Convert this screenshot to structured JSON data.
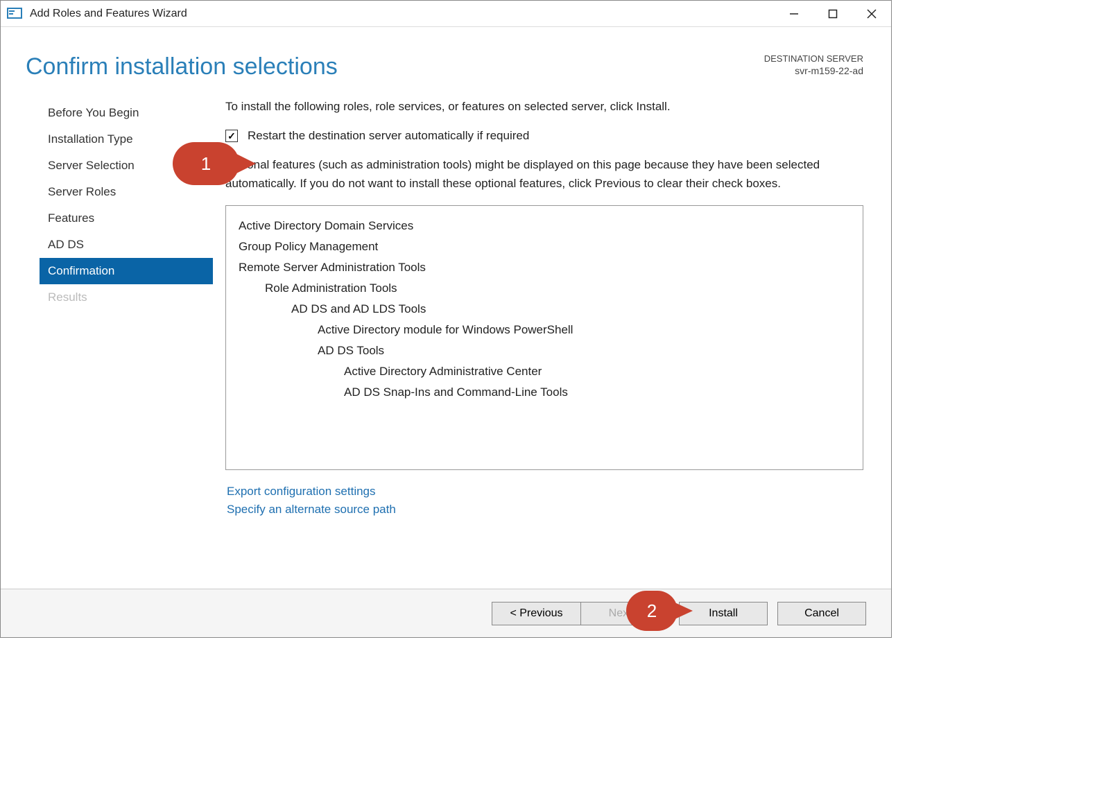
{
  "window": {
    "title": "Add Roles and Features Wizard"
  },
  "header": {
    "heading": "Confirm installation selections",
    "destLabel": "DESTINATION SERVER",
    "destValue": "svr-m159-22-ad"
  },
  "sidebar": {
    "items": [
      {
        "label": "Before You Begin",
        "active": false,
        "disabled": false
      },
      {
        "label": "Installation Type",
        "active": false,
        "disabled": false
      },
      {
        "label": "Server Selection",
        "active": false,
        "disabled": false
      },
      {
        "label": "Server Roles",
        "active": false,
        "disabled": false
      },
      {
        "label": "Features",
        "active": false,
        "disabled": false
      },
      {
        "label": "AD DS",
        "active": false,
        "disabled": false
      },
      {
        "label": "Confirmation",
        "active": true,
        "disabled": false
      },
      {
        "label": "Results",
        "active": false,
        "disabled": true
      }
    ]
  },
  "main": {
    "intro": "To install the following roles, role services, or features on selected server, click Install.",
    "checkbox": {
      "checked": true,
      "label": "Restart the destination server automatically if required"
    },
    "optional": "Optional features (such as administration tools) might be displayed on this page because they have been selected automatically. If you do not want to install these optional features, click Previous to clear their check boxes.",
    "selections": [
      {
        "label": "Active Directory Domain Services",
        "indent": 0
      },
      {
        "label": "Group Policy Management",
        "indent": 0
      },
      {
        "label": "Remote Server Administration Tools",
        "indent": 0
      },
      {
        "label": "Role Administration Tools",
        "indent": 1
      },
      {
        "label": "AD DS and AD LDS Tools",
        "indent": 2
      },
      {
        "label": "Active Directory module for Windows PowerShell",
        "indent": 3
      },
      {
        "label": "AD DS Tools",
        "indent": 3
      },
      {
        "label": "Active Directory Administrative Center",
        "indent": 4
      },
      {
        "label": "AD DS Snap-Ins and Command-Line Tools",
        "indent": 4
      }
    ],
    "links": {
      "export": "Export configuration settings",
      "altSource": "Specify an alternate source path"
    }
  },
  "footer": {
    "previous": "< Previous",
    "next": "Next >",
    "install": "Install",
    "cancel": "Cancel"
  },
  "callouts": {
    "one": "1",
    "two": "2"
  }
}
